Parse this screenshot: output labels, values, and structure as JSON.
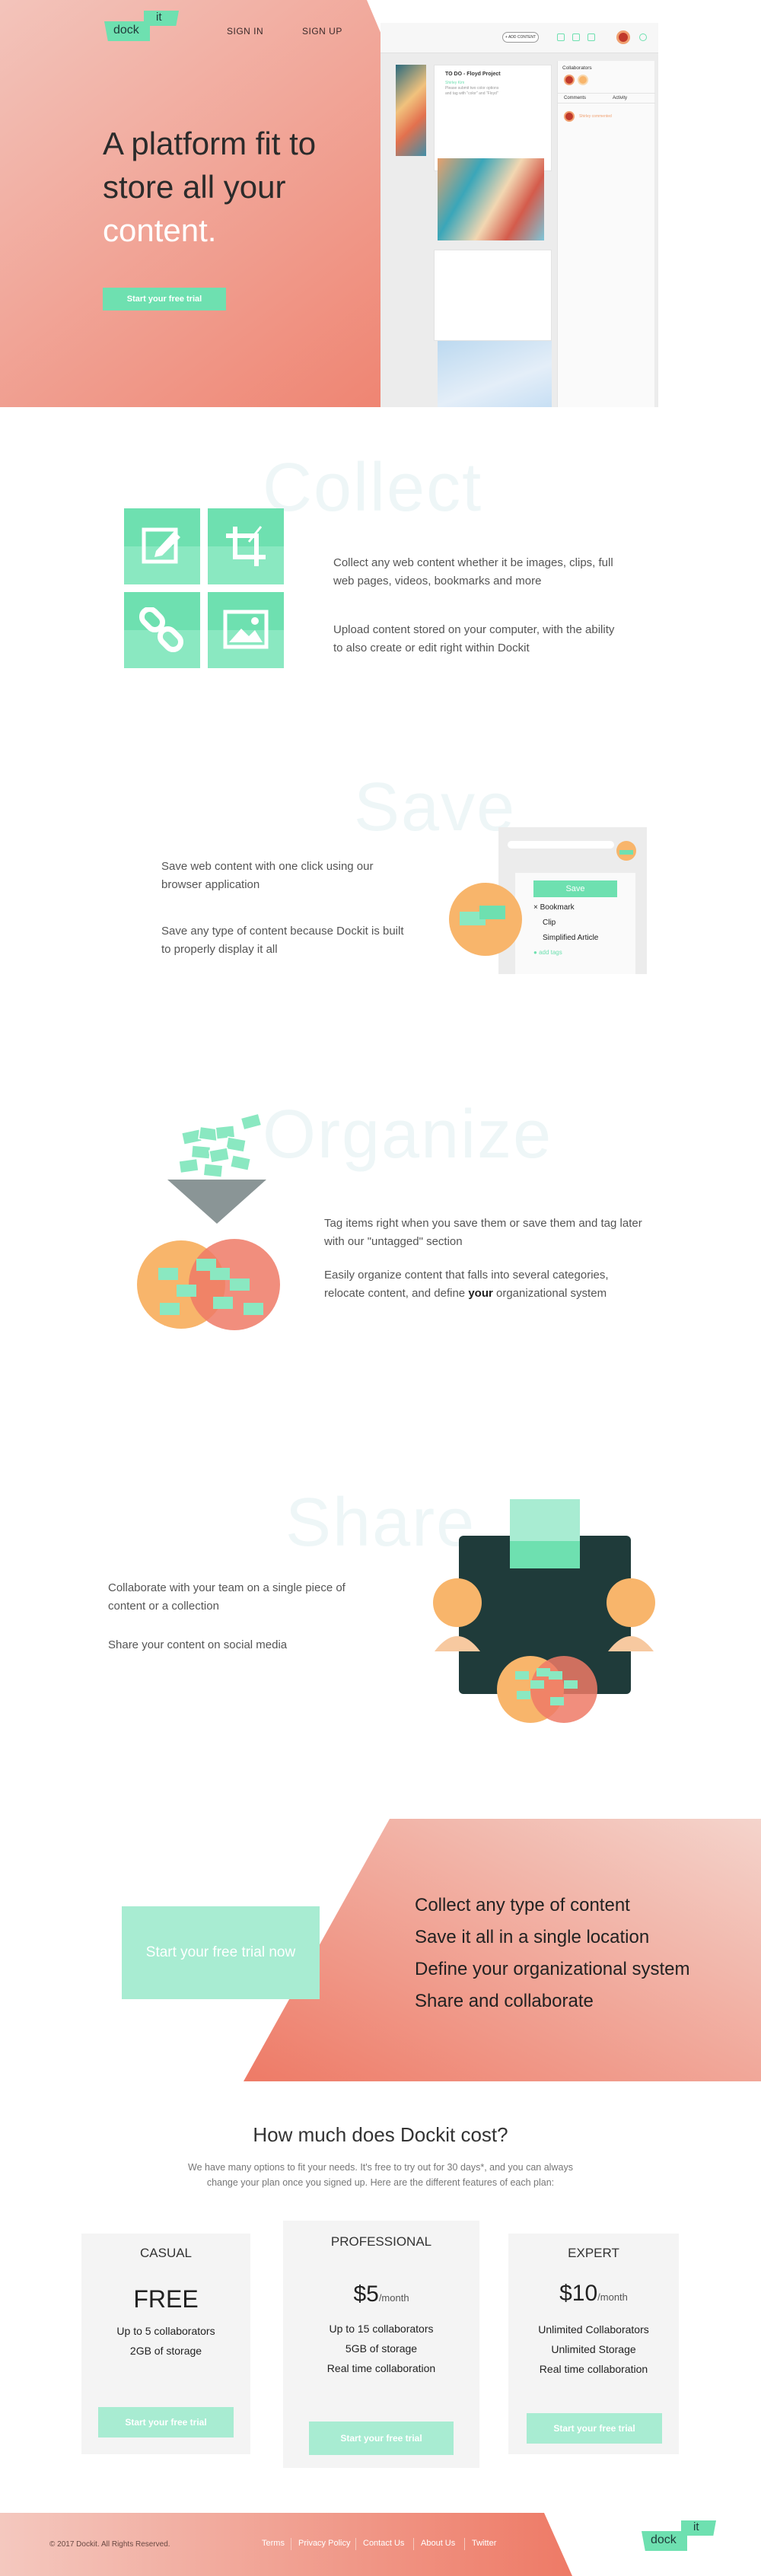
{
  "brand": {
    "logo_part1": "dock",
    "logo_part2": "it"
  },
  "nav": {
    "sign_in": "SIGN IN",
    "sign_up": "SIGN UP"
  },
  "hero": {
    "title_line1": "A platform fit to",
    "title_line2": "store all your",
    "title_line3": "content.",
    "cta": "Start your free trial"
  },
  "app_mock": {
    "new_button": "+ ADD CONTENT",
    "card_title": "TO DO - Floyd Project",
    "card_text_accent": "Shirley Kim",
    "card_text": "Please submit two color options and tag with \"color\" and \"Floyd\"",
    "collaborators_label": "Collaborators",
    "tab_comments": "Comments",
    "tab_activity": "Activity",
    "comment_preview": "Shirley commented"
  },
  "collect": {
    "heading": "Collect",
    "text1": "Collect any web content whether it be images, clips, full web pages, videos, bookmarks and more",
    "text2": "Upload content stored on your computer, with the ability to also create or edit right within Dockit"
  },
  "save": {
    "heading": "Save",
    "text1": "Save web content with one click using our browser application",
    "text2": "Save any type of content because Dockit is built to properly display it all",
    "popup_save": "Save",
    "popup_option1": "Bookmark",
    "popup_option2": "Clip",
    "popup_option3": "Simplified Article",
    "popup_add_tags": "add tags"
  },
  "organize": {
    "heading": "Organize",
    "text1": "Tag items right when you save them or save them and tag later with our \"untagged\" section",
    "text2_part1": "Easily organize content that falls into several categories, relocate content, and define ",
    "text2_bold": "your",
    "text2_part2": " organizational system"
  },
  "share": {
    "heading": "Share",
    "text1": "Collaborate with your team on a single piece of content or  a collection",
    "text2": "Share your content on social media"
  },
  "cta_band": {
    "button": "Start your free trial now",
    "lines": [
      "Collect any type of content",
      "Save it all in a single location",
      "Define your organizational system",
      "Share and collaborate"
    ]
  },
  "pricing": {
    "title": "How much does Dockit cost?",
    "subtitle": "We have many options to fit your needs. It's free to try out for 30 days*, and you can always change your plan once you signed up. Here are the different features of each plan:",
    "plans": [
      {
        "name": "CASUAL",
        "price": "FREE",
        "per": "",
        "features": [
          "Up to 5 collaborators",
          "2GB of storage"
        ],
        "cta": "Start your free trial"
      },
      {
        "name": "PROFESSIONAL",
        "price": "$5",
        "per": "/month",
        "features": [
          "Up to 15 collaborators",
          "5GB of storage",
          "Real time collaboration"
        ],
        "cta": "Start your free trial"
      },
      {
        "name": "EXPERT",
        "price": "$10",
        "per": "/month",
        "features": [
          "Unlimited Collaborators",
          "Unlimited Storage",
          "Real time collaboration"
        ],
        "cta": "Start your free trial"
      }
    ]
  },
  "footer": {
    "copyright": "© 2017 Dockit. All Rights Reserved.",
    "links": [
      "Terms",
      "Privacy Policy",
      "Contact Us",
      "About Us",
      "Twitter"
    ]
  },
  "colors": {
    "mint": "#6ee0b0",
    "mint_soft": "#a8ecd2",
    "coral": "#ee7a66",
    "blush": "#f4cfc7",
    "navy": "#1f3b3a",
    "orange": "#f8b56b"
  }
}
